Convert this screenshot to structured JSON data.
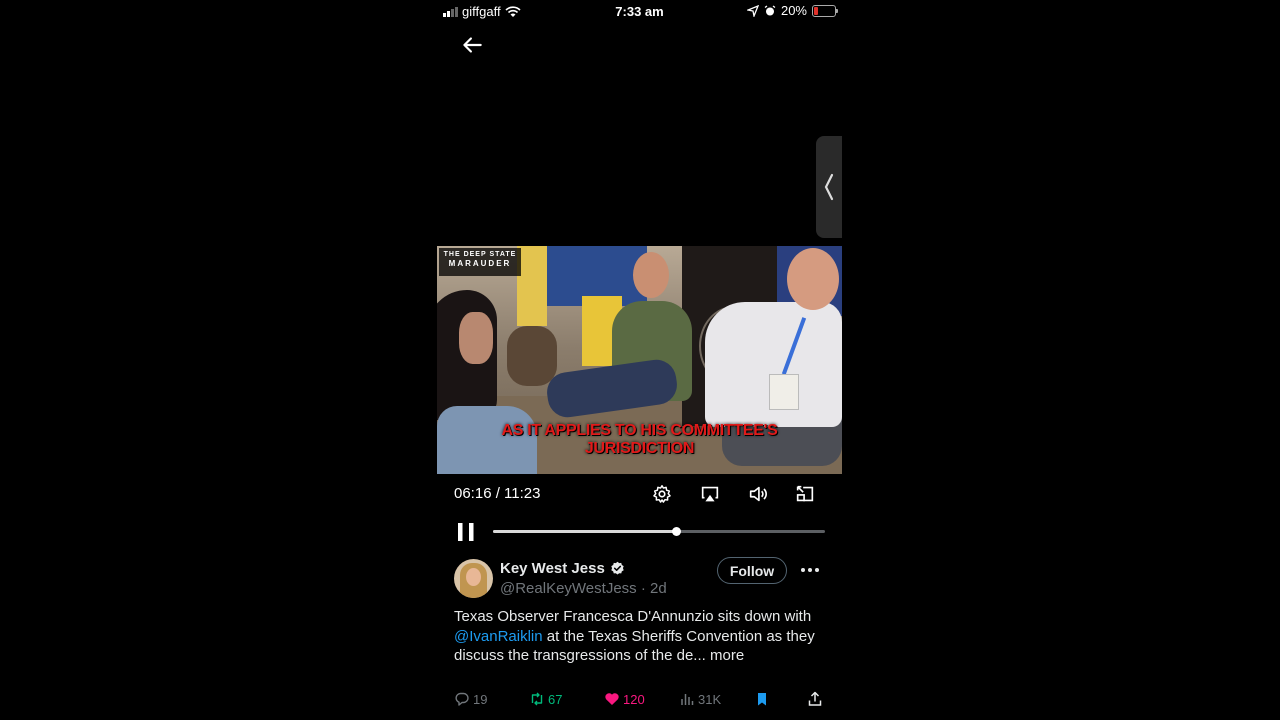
{
  "status_bar": {
    "carrier": "giffgaff",
    "time": "7:33 am",
    "battery": "20%",
    "battery_level": 0.2
  },
  "video": {
    "watermark_line1": "THE DEEP STATE",
    "watermark_line2": "MARAUDER",
    "caption_line1": "AS IT APPLIES TO HIS COMMITTEE'S",
    "caption_line2": "JURISDICTION",
    "timecode": "06:16 / 11:23",
    "progress_fraction": 0.552
  },
  "post": {
    "author_name": "Key West Jess",
    "handle": "@RealKeyWestJess",
    "separator": "·",
    "age": "2d",
    "follow_label": "Follow",
    "text_before_mention": "Texas Observer Francesca D'Annunzio sits down with ",
    "mention": "@IvanRaiklin",
    "text_after_mention": " at the Texas Sheriffs Convention as they discuss the transgressions of the de...",
    "more_label": " more"
  },
  "actions": {
    "replies": "19",
    "reposts": "67",
    "likes": "120",
    "views": "31K"
  },
  "colors": {
    "background": "#000000",
    "accent": "#1d9bf0",
    "repost_active": "#00ba7c",
    "like_active": "#f91880",
    "caption": "#e11a1a"
  }
}
